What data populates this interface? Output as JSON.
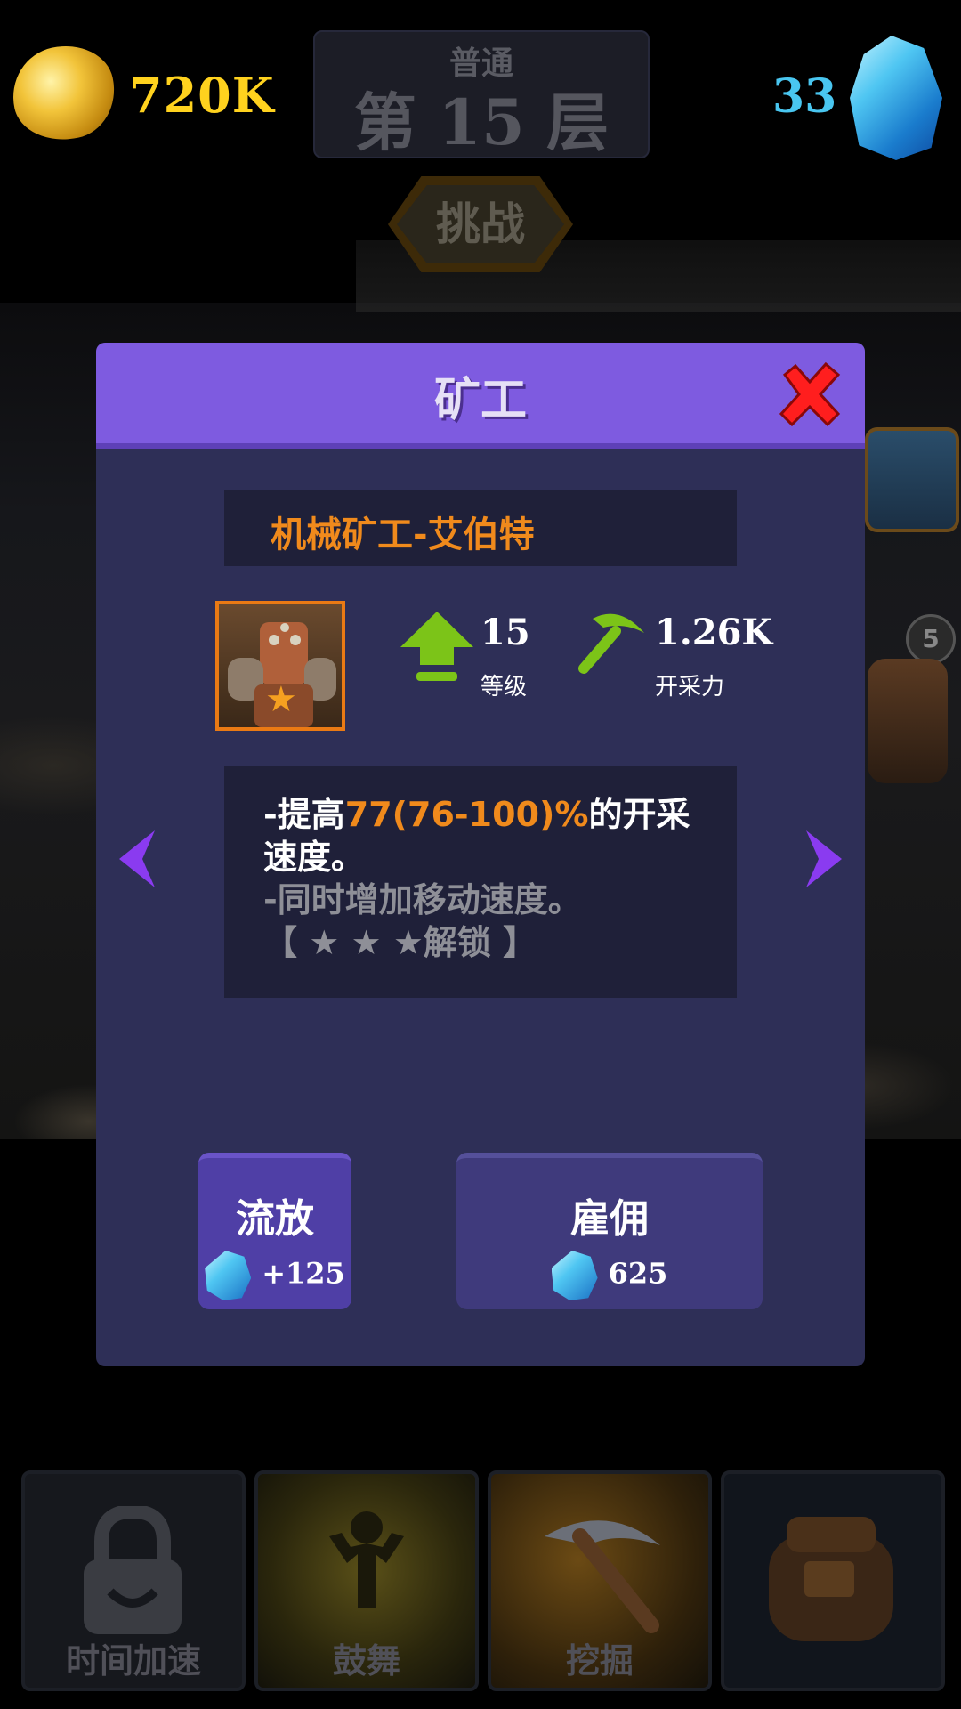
{
  "top": {
    "gold": "720K",
    "floor_mode": "普通",
    "floor_level": "第 15 层",
    "challenge_label": "挑战",
    "gems": "33"
  },
  "side": {
    "level_badge": "5"
  },
  "modal": {
    "title": "矿工",
    "miner_name": "机械矿工-艾伯特",
    "level_value": "15",
    "level_label": "等级",
    "power_value": "1.26K",
    "power_label": "开采力",
    "description": {
      "line1_prefix": "-提高",
      "line1_highlight": "77(76-100)%",
      "line1_suffix": "的开采",
      "line2": "速度。",
      "line3": "-同时增加移动速度。",
      "line4": "【 ★ ★ ★解锁 】"
    },
    "buttons": {
      "exile_label": "流放",
      "exile_value": "+125",
      "hire_label": "雇佣",
      "hire_value": "625"
    }
  },
  "skills": [
    {
      "label": "时间加速"
    },
    {
      "label": "鼓舞"
    },
    {
      "label": "挖掘"
    },
    {
      "label": ""
    }
  ],
  "colors": {
    "gold_text": "#ffd21e",
    "gem_text": "#49c6f0",
    "modal_bg": "#2e2f57",
    "modal_header": "#7e5be0",
    "highlight": "#f08a1c",
    "close_red": "#ff1e1e"
  }
}
